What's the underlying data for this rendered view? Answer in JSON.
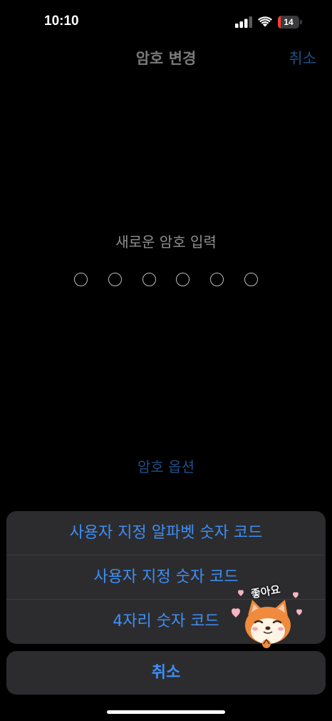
{
  "status_bar": {
    "time": "10:10",
    "battery_level": "14",
    "battery_fraction": 0.14
  },
  "nav": {
    "title": "암호 변경",
    "cancel_label": "취소"
  },
  "passcode": {
    "prompt": "새로운 암호 입력",
    "digit_count": 6,
    "options_label": "암호 옵션"
  },
  "action_sheet": {
    "items": [
      {
        "label": "사용자 지정 알파벳 숫자 코드"
      },
      {
        "label": "사용자 지정 숫자 코드"
      },
      {
        "label": "4자리 숫자 코드"
      }
    ],
    "cancel_label": "취소"
  },
  "sticker": {
    "text": "좋아요",
    "icon": "shiba-dog-sticker-icon"
  },
  "colors": {
    "accent_blue": "#3f8ef5",
    "dim_blue": "#1e4f86",
    "sheet_bg": "#2c2c2e",
    "battery_red": "#ff3b30"
  }
}
